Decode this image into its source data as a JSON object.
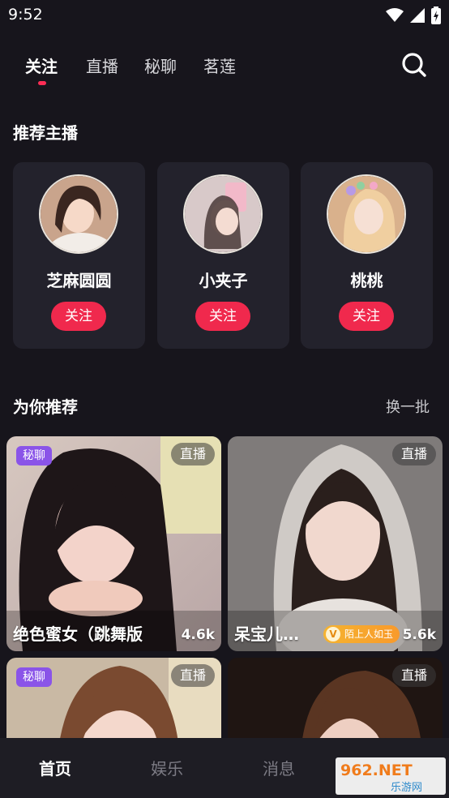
{
  "status_bar": {
    "time": "9:52"
  },
  "top_tabs": [
    {
      "label": "关注",
      "active": true
    },
    {
      "label": "直播",
      "active": false
    },
    {
      "label": "秘聊",
      "active": false
    },
    {
      "label": "茗莲",
      "active": false
    }
  ],
  "icons": {
    "search": "search-icon",
    "wifi": "wifi-icon",
    "signal": "signal-icon",
    "battery": "battery-icon"
  },
  "recommended_anchors": {
    "title": "推荐主播",
    "items": [
      {
        "name": "芝麻圆圆",
        "follow_label": "关注"
      },
      {
        "name": "小夹子",
        "follow_label": "关注"
      },
      {
        "name": "桃桃",
        "follow_label": "关注"
      }
    ]
  },
  "for_you": {
    "title": "为你推荐",
    "refresh_label": "换一批",
    "cards": [
      {
        "title": "绝色蜜女（跳舞版",
        "count": "4.6k",
        "live_tag": "直播",
        "chat_tag": "秘聊"
      },
      {
        "title": "呆宝儿…",
        "count": "5.6k",
        "live_tag": "直播",
        "badge": "陌上人如玉"
      },
      {
        "live_tag": "直播",
        "chat_tag": "秘聊"
      },
      {
        "live_tag": "直播"
      }
    ]
  },
  "bottom_nav": [
    {
      "label": "首页",
      "active": true
    },
    {
      "label": "娱乐",
      "active": false
    },
    {
      "label": "消息",
      "active": false
    }
  ],
  "watermark": {
    "line1": "962.NET",
    "line2": "乐游网"
  },
  "colors": {
    "accent": "#f0294d",
    "chat_tag": "#8a54e8",
    "background": "#17151c",
    "card": "#23222c"
  }
}
